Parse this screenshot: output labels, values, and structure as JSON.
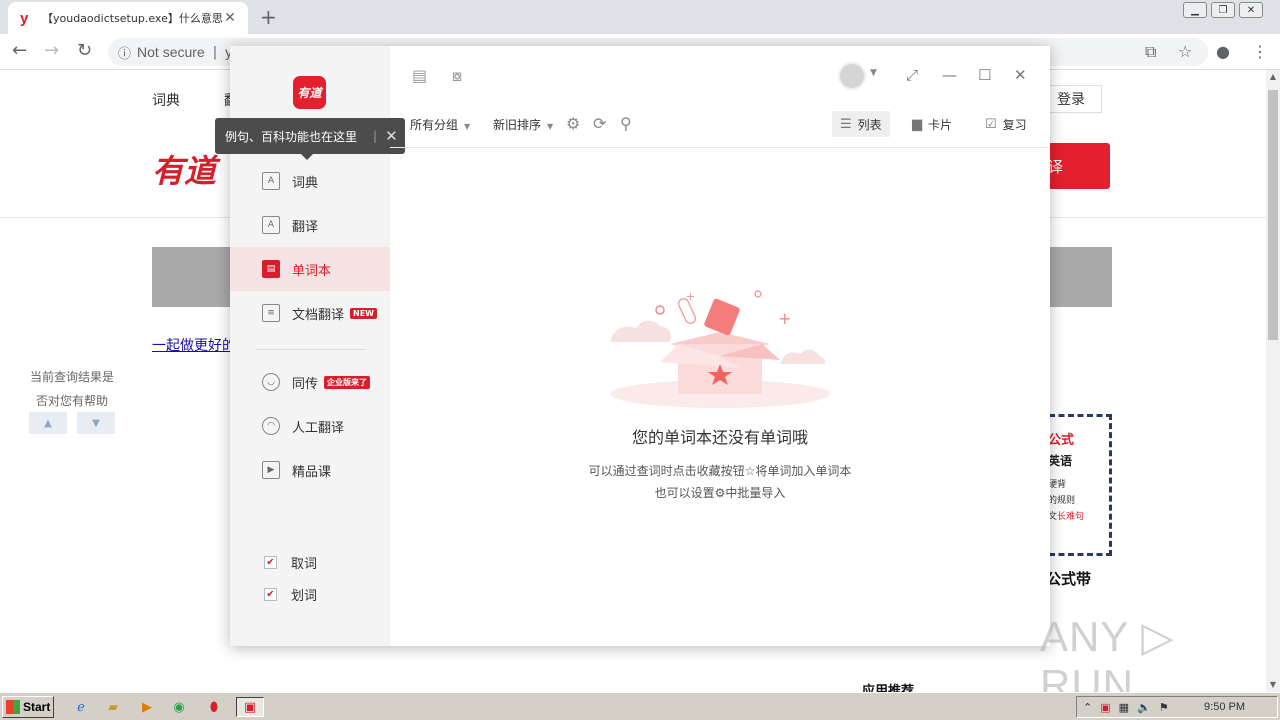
{
  "browser": {
    "tab_title": "【youdaodictsetup.exe】什么意思_英",
    "tab_favicon": "y",
    "address_security": "Not secure",
    "address_text": "y"
  },
  "webpage": {
    "nav": [
      "词典",
      "翻"
    ],
    "login": "登录",
    "logo": "有道",
    "red_button": "译",
    "link": "一起做更好的",
    "feedback_line1": "当前查询结果是",
    "feedback_line2": "否对您有帮助",
    "ad": {
      "line1": "公式",
      "line2": "英语",
      "line3": "硬背",
      "line4": "的规则",
      "line5_prefix": "文",
      "line5_highlight": "长难句",
      "caption": "公式带"
    },
    "recommend": "应用推荐"
  },
  "dict": {
    "logo_text": "有道",
    "tooltip": "例句、百科功能也在这里",
    "nav": [
      {
        "label": "词典",
        "icon": "A"
      },
      {
        "label": "翻译",
        "icon": "A"
      },
      {
        "label": "单词本",
        "icon": "▤"
      },
      {
        "label": "文档翻译",
        "icon": "≡",
        "badge": "NEW"
      },
      {
        "label": "同传",
        "icon": "◡",
        "badge": "企业版来了"
      },
      {
        "label": "人工翻译",
        "icon": "◠"
      },
      {
        "label": "精品课",
        "icon": "▶"
      }
    ],
    "checks": [
      {
        "label": "取词",
        "checked": true
      },
      {
        "label": "划词",
        "checked": true
      }
    ],
    "filters": {
      "group": "所有分组",
      "sort": "新旧排序"
    },
    "views": {
      "list": "列表",
      "card": "卡片",
      "review": "复习"
    },
    "empty_title": "您的单词本还没有单词哦",
    "empty_line1": "可以通过查词时点击收藏按钮☆将单词加入单词本",
    "empty_line2": "也可以设置⚙中批量导入"
  },
  "taskbar": {
    "start": "Start",
    "clock": "9:50 PM"
  },
  "watermark": "ANY ▷ RUN",
  "colors": {
    "brand_red": "#d81e2b",
    "active_bg": "#f5e3e3"
  }
}
